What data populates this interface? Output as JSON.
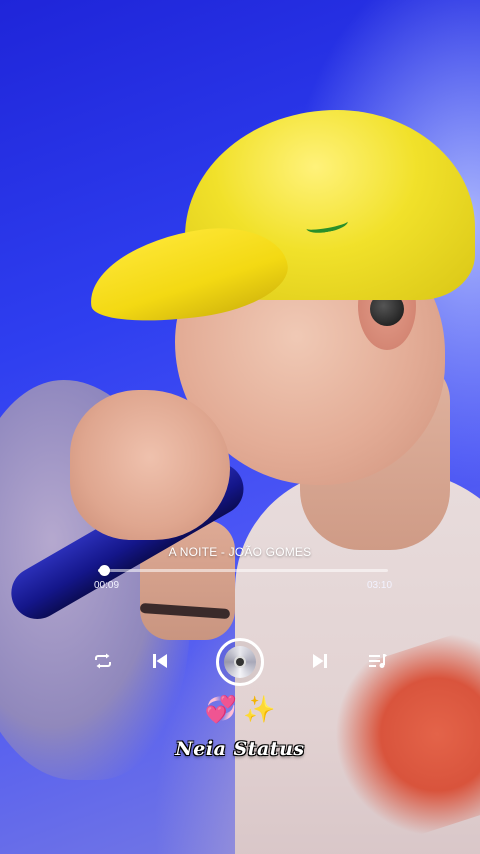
{
  "player": {
    "song_title": "A NOITE - JOÃO GOMES",
    "current_time": "00:09",
    "total_time": "03:10",
    "progress_fraction": 0.02
  },
  "controls": {
    "repeat_icon": "repeat-icon",
    "previous_icon": "skip-previous-icon",
    "play_icon": "disc-icon",
    "next_icon": "skip-next-icon",
    "playlist_icon": "playlist-icon"
  },
  "decor": {
    "emoji_left": "💞",
    "emoji_right": "✨",
    "signature": "Neia Status"
  },
  "colors": {
    "background_blue": "#2a2ee0",
    "cap_yellow": "#f1e12a",
    "control_white": "#ffffff"
  }
}
